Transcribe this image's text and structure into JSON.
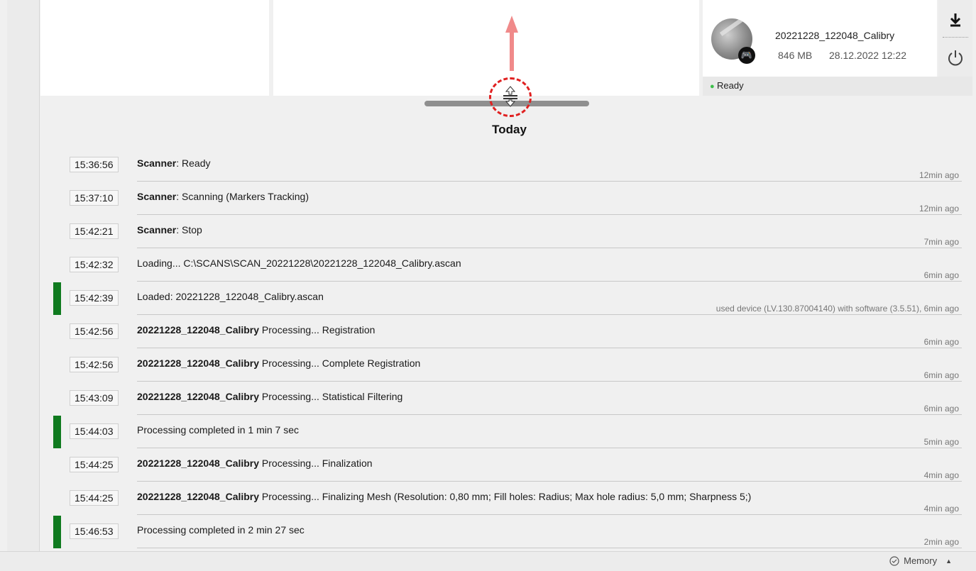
{
  "device": {
    "name": "20221228_122048_Calibry",
    "size": "846 MB",
    "date": "28.12.2022 12:22",
    "status": "Ready",
    "thumbnail_icon": "scan-thumbnail",
    "badge_icon": "gamepad-icon"
  },
  "tools": {
    "download_icon": "download-icon",
    "power_icon": "power-icon"
  },
  "log": {
    "heading": "Today",
    "entries": [
      {
        "time": "15:36:56",
        "bold": "Scanner",
        "text": ": Ready",
        "ago": "12min ago",
        "marked": false
      },
      {
        "time": "15:37:10",
        "bold": "Scanner",
        "text": ": Scanning (Markers Tracking)",
        "ago": "12min ago",
        "marked": false
      },
      {
        "time": "15:42:21",
        "bold": "Scanner",
        "text": ": Stop",
        "ago": "7min ago",
        "marked": false
      },
      {
        "time": "15:42:32",
        "bold": "",
        "text": "Loading... C:\\SCANS\\SCAN_20221228\\20221228_122048_Calibry.ascan",
        "ago": "6min ago",
        "marked": false
      },
      {
        "time": "15:42:39",
        "bold": "",
        "text": "Loaded: 20221228_122048_Calibry.ascan",
        "ago": "used device (LV.130.87004140) with software (3.5.51), 6min ago",
        "marked": true
      },
      {
        "time": "15:42:56",
        "bold": "20221228_122048_Calibry",
        "text": " Processing... Registration",
        "ago": "6min ago",
        "marked": false
      },
      {
        "time": "15:42:56",
        "bold": "20221228_122048_Calibry",
        "text": " Processing... Complete Registration",
        "ago": "6min ago",
        "marked": false
      },
      {
        "time": "15:43:09",
        "bold": "20221228_122048_Calibry",
        "text": " Processing... Statistical Filtering",
        "ago": "6min ago",
        "marked": false
      },
      {
        "time": "15:44:03",
        "bold": "",
        "text": "Processing completed in 1 min 7 sec",
        "ago": "5min ago",
        "marked": true
      },
      {
        "time": "15:44:25",
        "bold": "20221228_122048_Calibry",
        "text": " Processing... Finalization",
        "ago": "4min ago",
        "marked": false
      },
      {
        "time": "15:44:25",
        "bold": "20221228_122048_Calibry",
        "text": " Processing... Finalizing Mesh (Resolution: 0,80 mm; Fill holes: Radius; Max hole radius: 5,0 mm; Sharpness 5;)",
        "ago": "4min ago",
        "marked": false
      },
      {
        "time": "15:46:53",
        "bold": "",
        "text": "Processing completed in 2 min 27 sec",
        "ago": "2min ago",
        "marked": true
      }
    ]
  },
  "footer": {
    "memory_label": "Memory"
  },
  "colors": {
    "status_ready": "#3cbf4a",
    "success_marker": "#0f7a1f",
    "drag_highlight": "#e02020",
    "arrow": "#f08a8a"
  }
}
